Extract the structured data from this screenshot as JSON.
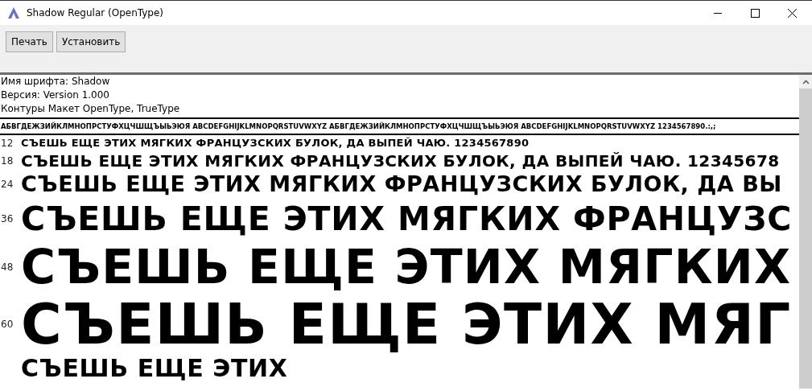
{
  "window": {
    "title": "Shadow Regular (OpenType)"
  },
  "toolbar": {
    "buttons": [
      "Печать",
      "Установить"
    ]
  },
  "info": [
    "Имя шрифта: Shadow",
    "Версия: Version 1.000",
    "Контуры Макет OpenType, TrueType"
  ],
  "charset": "АБВГДЕЖЗИЙКЛМНОПРСТУФХЦЧШЩЪЫЬЭЮЯ ABCDEFGHIJKLMNOPQRSTUVWXYZ АБВГДЕЖЗИЙКЛМНОПРСТУФХЦЧШЩЪЫЬЭЮЯ ABCDEFGHIJKLMNOPQRSTUVWXYZ 1234567890.:,;",
  "samples": [
    {
      "size": "12",
      "text": "СЪЕШЬ ЕЩЕ ЭТИХ МЯГКИХ ФРАНЦУЗСКИХ БУЛОК, ДА ВЫПЕЙ ЧАЮ. 1234567890"
    },
    {
      "size": "18",
      "text": "СЪЕШЬ ЕЩЕ ЭТИХ МЯГКИХ ФРАНЦУЗСКИХ БУЛОК, ДА ВЫПЕЙ ЧАЮ. 12345678"
    },
    {
      "size": "24",
      "text": "СЪЕШЬ ЕЩЕ ЭТИХ МЯГКИХ ФРАНЦУЗСКИХ БУЛОК, ДА ВЫ"
    },
    {
      "size": "36",
      "text": "СЪЕШЬ ЕЩЕ ЭТИХ МЯГКИХ ФРАНЦУЗС"
    },
    {
      "size": "48",
      "text": "СЪЕШЬ ЕЩЕ ЭТИХ МЯГКИХ"
    },
    {
      "size": "60",
      "text": "СЪЕШЬ ЕЩЕ ЭТИХ МЯГ"
    },
    {
      "text": "СЪЕШЬ ЕЩЕ ЭТИХ"
    }
  ]
}
